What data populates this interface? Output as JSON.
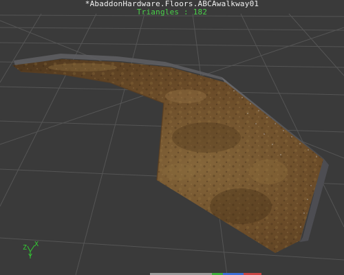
{
  "viewer": {
    "mesh_name": "*AbaddonHardware.Floors.ABCAwalkway01",
    "triangles_label": "Triangles : 182"
  },
  "axis_gizmo": {
    "x_label": "X",
    "y_label": "Y",
    "z_label": "Z"
  },
  "colors": {
    "background": "#3a3a3a",
    "grid": "#555555",
    "title_text": "#f2f2f2",
    "triangles_text": "#4ad14a",
    "gizmo": "#33cc33",
    "texture_base": "#7a5a30"
  }
}
